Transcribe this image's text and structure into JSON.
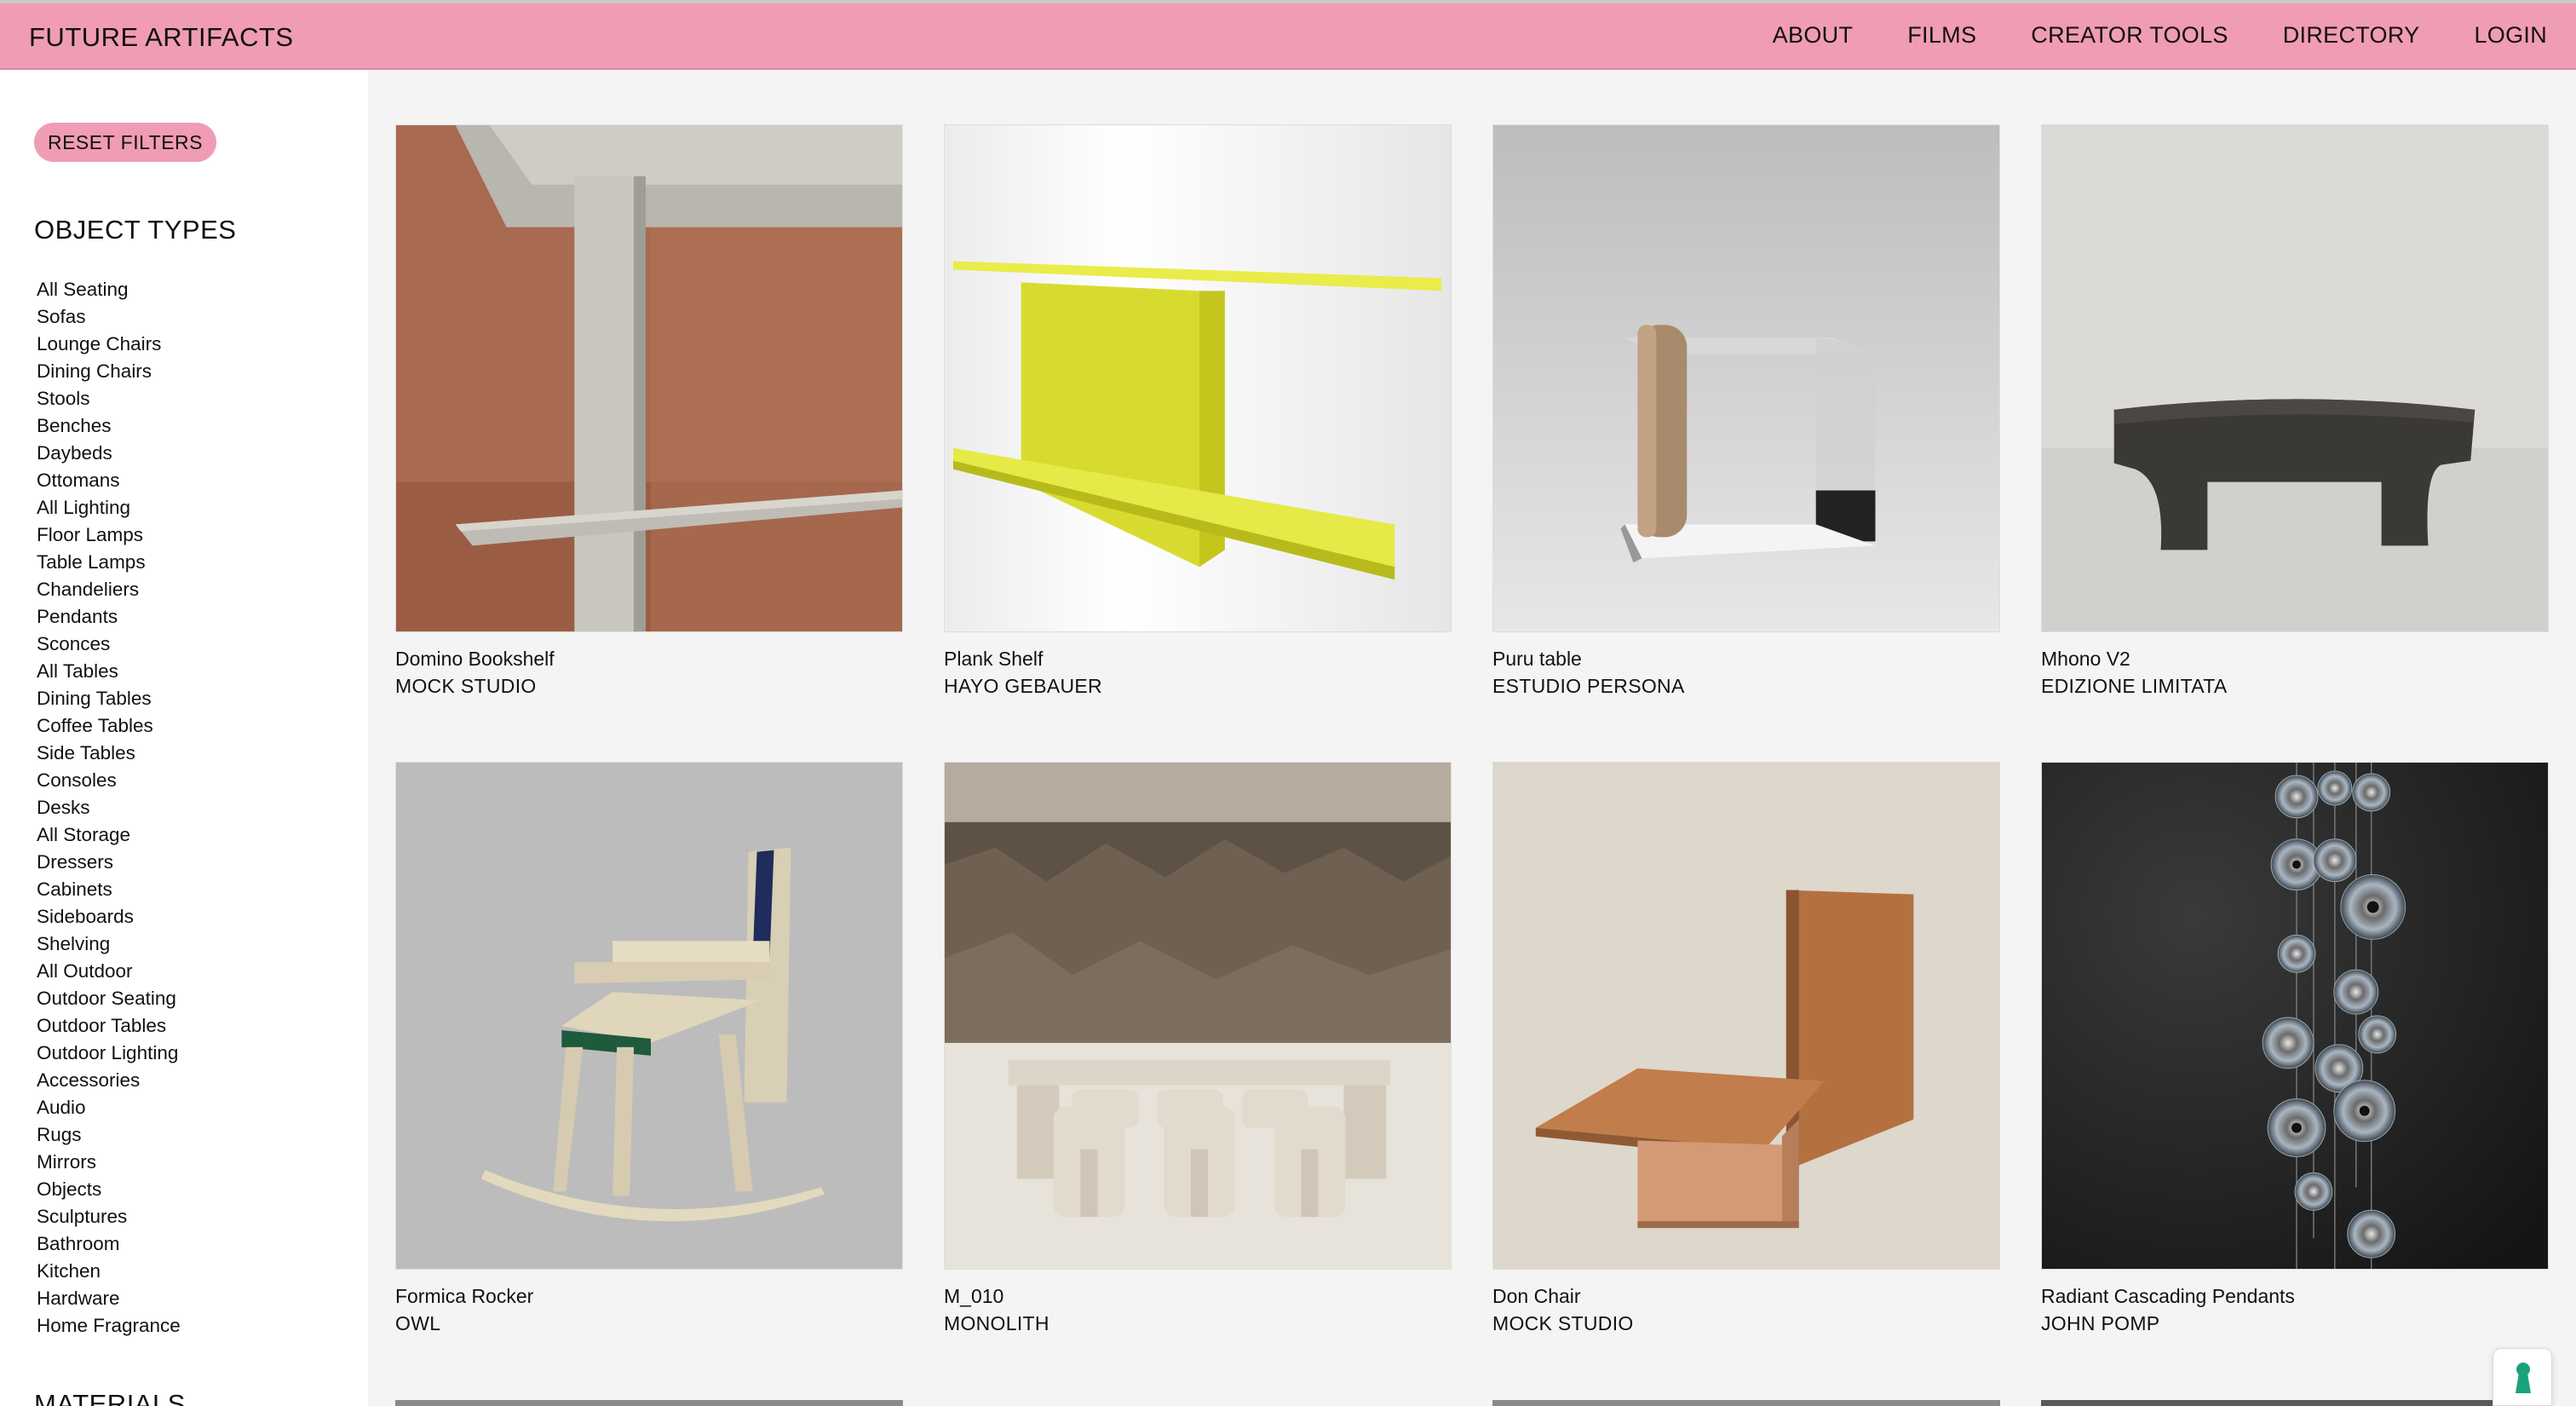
{
  "header": {
    "logo": "FUTURE ARTIFACTS",
    "nav": [
      "ABOUT",
      "FILMS",
      "CREATOR TOOLS",
      "DIRECTORY",
      "LOGIN"
    ],
    "background": "#f09cb4"
  },
  "sidebar": {
    "reset_label": "RESET FILTERS",
    "object_types_title": "OBJECT TYPES",
    "object_types": [
      "All Seating",
      "Sofas",
      "Lounge Chairs",
      "Dining Chairs",
      "Stools",
      "Benches",
      "Daybeds",
      "Ottomans",
      "All Lighting",
      "Floor Lamps",
      "Table Lamps",
      "Chandeliers",
      "Pendants",
      "Sconces",
      "All Tables",
      "Dining Tables",
      "Coffee Tables",
      "Side Tables",
      "Consoles",
      "Desks",
      "All Storage",
      "Dressers",
      "Cabinets",
      "Sideboards",
      "Shelving",
      "All Outdoor",
      "Outdoor Seating",
      "Outdoor Tables",
      "Outdoor Lighting",
      "Accessories",
      "Audio",
      "Rugs",
      "Mirrors",
      "Objects",
      "Sculptures",
      "Bathroom",
      "Kitchen",
      "Hardware",
      "Home Fragrance"
    ],
    "materials_title": "MATERIALS"
  },
  "products": [
    {
      "title": "Domino Bookshelf",
      "maker": "MOCK STUDIO",
      "image": "aluminum-bookshelf"
    },
    {
      "title": "Plank Shelf",
      "maker": "HAYO GEBAUER",
      "image": "yellow-wall-shelf"
    },
    {
      "title": "Puru table",
      "maker": "ESTUDIO PERSONA",
      "image": "glass-side-table"
    },
    {
      "title": "Mhono V2",
      "maker": "EDIZIONE LIMITATA",
      "image": "dark-wood-bench"
    },
    {
      "title": "Formica Rocker",
      "maker": "OWL",
      "image": "rocking-chair"
    },
    {
      "title": "M_010",
      "maker": "MONOLITH",
      "image": "stone-dining-set"
    },
    {
      "title": "Don Chair",
      "maker": "MOCK STUDIO",
      "image": "wood-lounge-chair"
    },
    {
      "title": "Radiant Cascading Pendants",
      "maker": "JOHN POMP",
      "image": "glass-disc-pendants"
    }
  ]
}
